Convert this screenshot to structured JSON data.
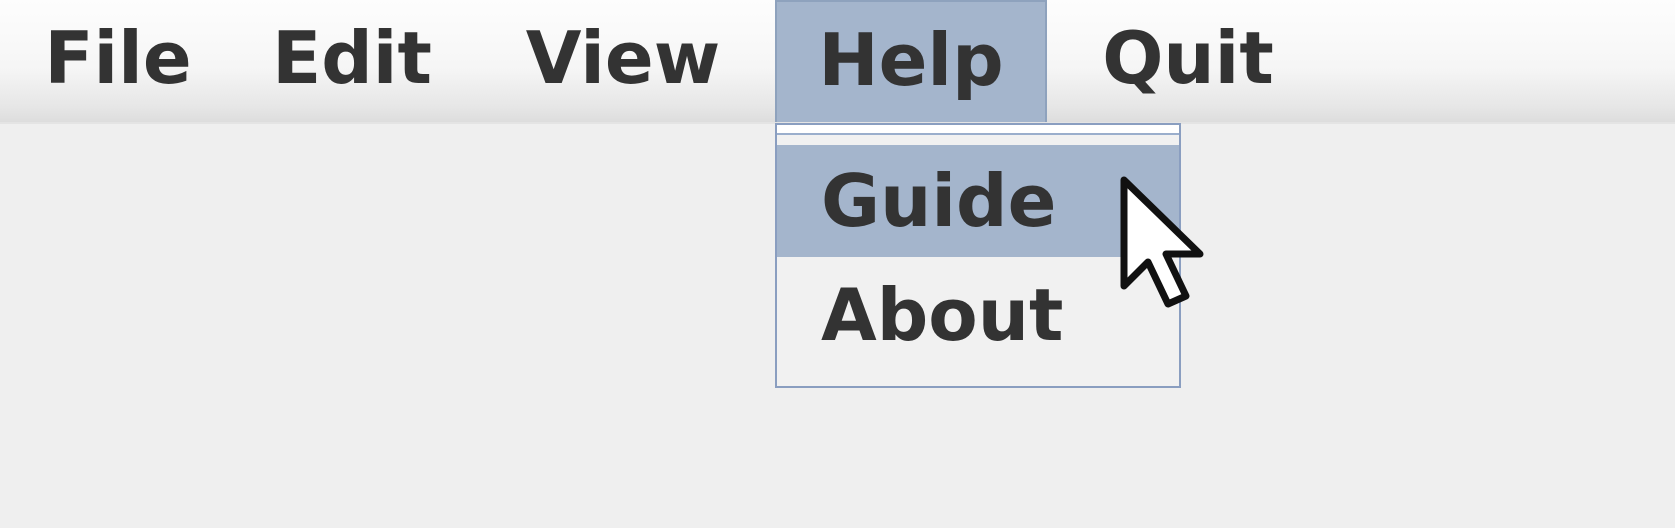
{
  "menubar": {
    "items": [
      {
        "label": "File"
      },
      {
        "label": "Edit"
      },
      {
        "label": "View"
      },
      {
        "label": "Help"
      },
      {
        "label": "Quit"
      }
    ],
    "active": "Help"
  },
  "help_menu": {
    "items": [
      {
        "label": "Guide"
      },
      {
        "label": "About"
      }
    ],
    "highlighted": "Guide"
  },
  "colors": {
    "highlight": "#a4b5cc",
    "border": "#8a9ec0",
    "text": "#333333",
    "background": "#efefef"
  },
  "icons": {
    "pointer": "mouse-pointer-icon"
  }
}
